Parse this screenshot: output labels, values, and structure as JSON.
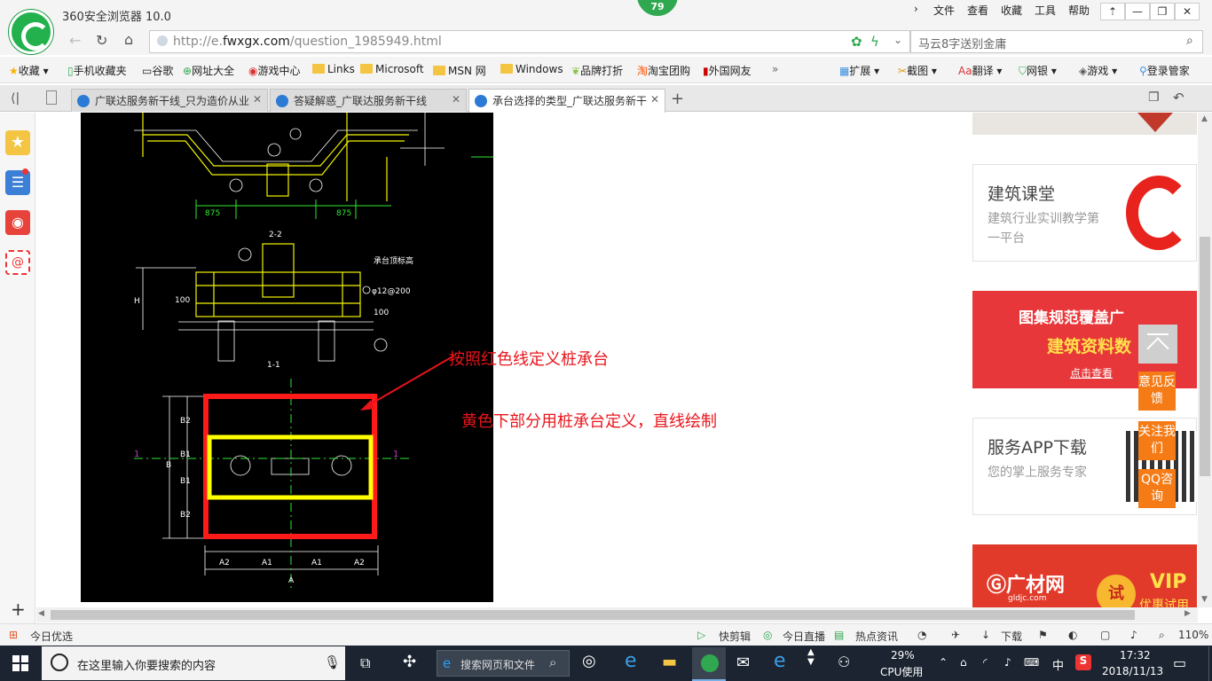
{
  "app": {
    "title": "360安全浏览器 10.0",
    "badge": "79"
  },
  "menu": [
    "文件",
    "查看",
    "收藏",
    "工具",
    "帮助"
  ],
  "address": {
    "url_prefix": "http://e.",
    "url_domain": "fwxgx.com",
    "url_path": "/question_1985949.html",
    "search_placeholder": "马云8字送别金庸"
  },
  "bookmarks": [
    "收藏",
    "手机收藏夹",
    "谷歌",
    "网址大全",
    "游戏中心",
    "Links",
    "Microsoft",
    "MSN 网",
    "Windows",
    "品牌打折",
    "淘宝团购",
    "外国网友"
  ],
  "toolbar_right": [
    "扩展",
    "截图",
    "翻译",
    "网银",
    "游戏",
    "登录管家"
  ],
  "tabs": [
    {
      "label": "广联达服务新干线_只为造价从业"
    },
    {
      "label": "答疑解惑_广联达服务新干线"
    },
    {
      "label": "承台选择的类型_广联达服务新干"
    }
  ],
  "annotations": {
    "line1": "按照红色线定义桩承台",
    "line2": "黄色下部分用桩承台定义，直线绘制"
  },
  "cad_labels": {
    "section1": "2-2",
    "section2": "1-1",
    "rebar": "φ12@200",
    "top_label": "承台顶标高",
    "dim875a": "875",
    "dim875b": "875",
    "dim100a": "100",
    "dim100b": "100",
    "A": "A",
    "A1": "A1",
    "A2": "A2",
    "B": "B",
    "B1": "B1",
    "B2": "B2",
    "H": "H"
  },
  "side_cards": [
    {
      "title": "建筑课堂",
      "desc": "建筑行业实训教学第一平台"
    },
    {
      "title": "图集规范覆盖广",
      "subtitle": "建筑资料数",
      "link": "点击查看"
    },
    {
      "title": "服务APP下载",
      "desc": "您的掌上服务专家"
    },
    {
      "brand": "广材网",
      "domain": "gldjc.com",
      "vip": "VIP",
      "try": "试",
      "vip_sub": "优惠试用"
    }
  ],
  "float_buttons": [
    "意见反馈",
    "关注我们",
    "QQ咨询"
  ],
  "status": {
    "left": "今日优选",
    "items": [
      "快剪辑",
      "今日直播",
      "热点资讯",
      "下载"
    ],
    "zoom": "110%"
  },
  "taskbar": {
    "search": "在这里输入你要搜索的内容",
    "web_search": "搜索网页和文件",
    "cpu_pct": "29%",
    "cpu_label": "CPU使用",
    "ime": "中",
    "time": "17:32",
    "date": "2018/11/13"
  }
}
